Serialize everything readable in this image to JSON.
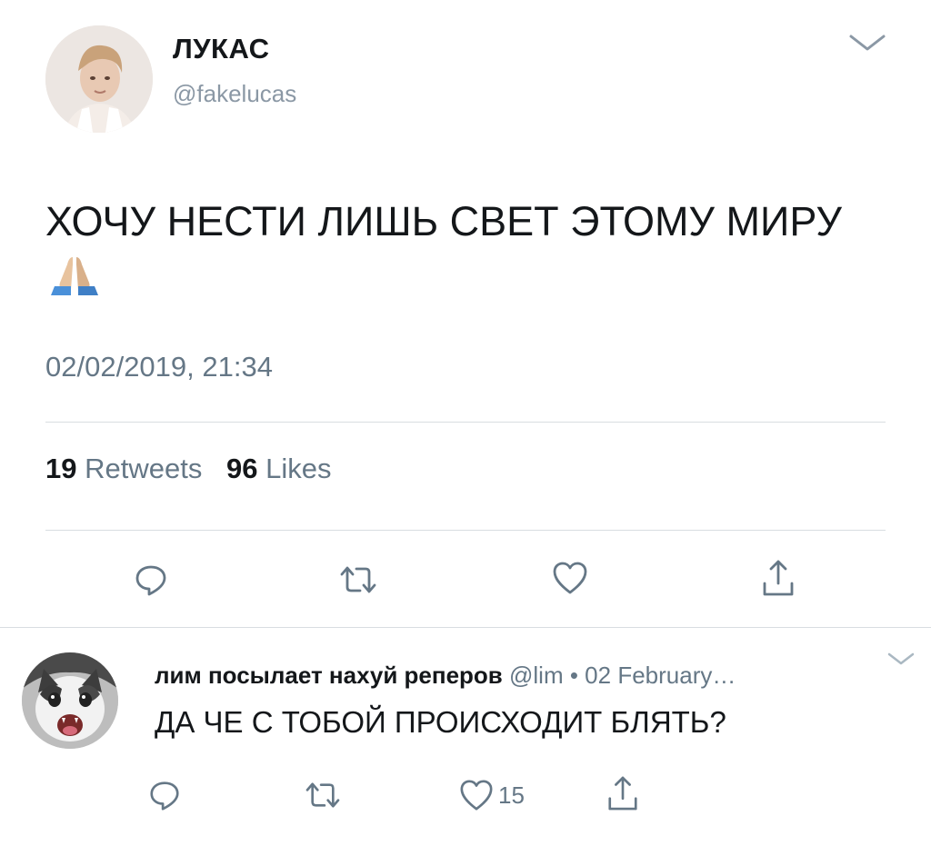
{
  "main_tweet": {
    "author_name": "ЛУКАС",
    "author_handle": "@fakelucas",
    "text": "ХОЧУ НЕСТИ ЛИШЬ СВЕТ ЭТОМУ МИРУ",
    "emoji": "folded-hands-emoji",
    "timestamp": "02/02/2019, 21:34",
    "retweets_count": "19",
    "retweets_label": "Retweets",
    "likes_count": "96",
    "likes_label": "Likes"
  },
  "reply_tweet": {
    "author_name": "лим посылает нахуй реперов",
    "meta": "@lim • 02 February…",
    "text": "ДА ЧЕ С ТОБОЙ ПРОИСХОДИТ БЛЯТЬ?",
    "likes_count": "15"
  },
  "icons": {
    "reply": "reply-icon",
    "retweet": "retweet-icon",
    "like": "heart-icon",
    "share": "share-icon",
    "menu": "chevron-down-icon"
  },
  "colors": {
    "text": "#14171a",
    "secondary": "#657786",
    "icon": "#657786",
    "divider": "#d8dde1"
  }
}
